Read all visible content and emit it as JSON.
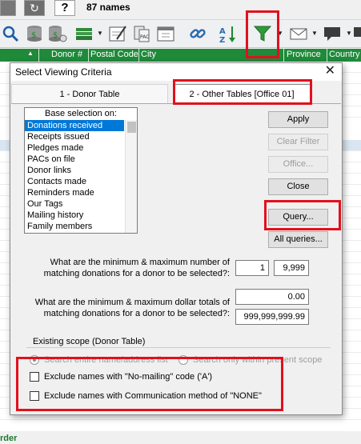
{
  "app": {
    "names_count": "87 names",
    "help_glyph": "?",
    "refresh_glyph": "↻",
    "bottom_partial_text": "rder"
  },
  "grid": {
    "columns": [
      "Donor #",
      "Postal Code",
      "City",
      "Province",
      "Country"
    ]
  },
  "toolbar": {
    "icons": [
      "search-icon",
      "database-icon",
      "database-multi-icon",
      "books-icon",
      "calendar-pen-icon",
      "pac-icon",
      "calendar-icon",
      "link-icon",
      "sort-az-icon",
      "filter-icon",
      "mail-icon",
      "chat-icon"
    ]
  },
  "dialog": {
    "title": "Select Viewing Criteria",
    "close_glyph": "✕",
    "tabs": [
      {
        "label": "1 - Donor Table"
      },
      {
        "label": "2 - Other Tables [Office 01]"
      }
    ],
    "base_selection": {
      "header": "Base selection on:",
      "items": [
        "Donations received",
        "Receipts issued",
        "Pledges made",
        "PACs on file",
        "Donor links",
        "Contacts made",
        "Reminders made",
        "Our Tags",
        "Mailing history",
        "Family members"
      ],
      "selected": "Donations received"
    },
    "buttons": {
      "apply": "Apply",
      "clear_filter": "Clear Filter",
      "office": "Office...",
      "close": "Close",
      "query": "Query...",
      "all_queries": "All queries..."
    },
    "count_question": {
      "line1": "What are the minimum & maximum number of",
      "line2": "matching donations for a donor to be selected?:",
      "min": "1",
      "max": "9,999"
    },
    "dollar_question": {
      "line1": "What are the minimum & maximum dollar totals of",
      "line2": "matching donations for a donor to be selected?:",
      "min": "0.00",
      "max": "999,999,999.99"
    },
    "scope": {
      "label": "Existing scope  (Donor Table)",
      "option_all": "Search entire name/address list",
      "option_current": "Search only within present scope"
    },
    "checkboxes": {
      "no_mailing": "Exclude names with \"No-mailing\" code ('A')",
      "comm_none": "Exclude names with Communication method of \"NONE\""
    }
  },
  "colors": {
    "grid_header": "#1f8a3a",
    "selection": "#0078d7",
    "highlight": "#e2101e"
  }
}
